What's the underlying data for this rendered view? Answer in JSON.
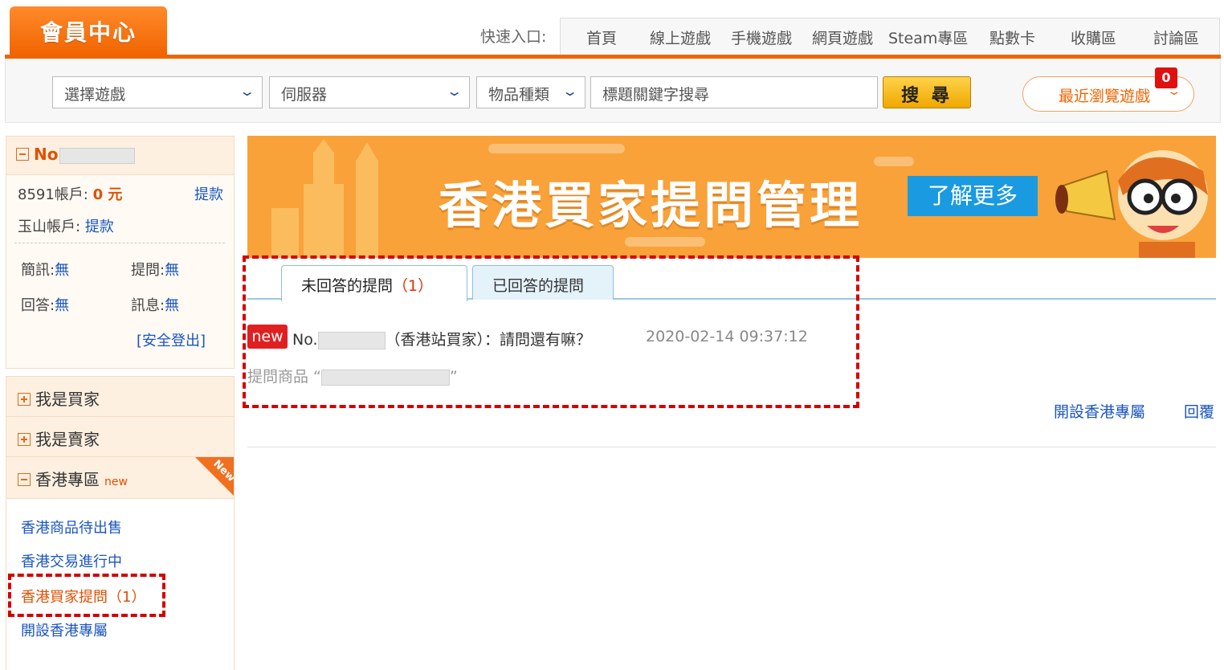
{
  "header": {
    "member_center": "會員中心",
    "quick_entry_label": "快速入口:",
    "nav": [
      "首頁",
      "線上遊戲",
      "手機遊戲",
      "網頁遊戲",
      "Steam專區",
      "點數卡",
      "收購區",
      "討論區"
    ]
  },
  "search": {
    "game_select": "選擇遊戲",
    "server_select": "伺服器",
    "item_type_select": "物品種類",
    "keyword_placeholder": "標題關鍵字搜尋",
    "search_button": "搜 尋",
    "recent_games": "最近瀏覽遊戲",
    "recent_count": "0"
  },
  "account": {
    "user_prefix": "No",
    "balance_label": "8591帳戶:",
    "balance_value": "0 元",
    "withdraw": "提款",
    "yushan_label": "玉山帳戶:",
    "yushan_withdraw": "提款",
    "sms_label": "簡訊:",
    "sms_value": "無",
    "ask_label": "提問:",
    "ask_value": "無",
    "reply_label": "回答:",
    "reply_value": "無",
    "msg_label": "訊息:",
    "msg_value": "無",
    "logout": "[安全登出]"
  },
  "menu": {
    "buyer": "我是買家",
    "seller": "我是賣家",
    "hk_zone": "香港專區",
    "hk_new": "new",
    "hk_ribbon": "New",
    "sub_items": [
      "香港商品待出售",
      "香港交易進行中",
      "香港買家提問（1）",
      "開設香港專屬"
    ]
  },
  "banner": {
    "title": "香港買家提問管理",
    "more": "了解更多"
  },
  "tabs": {
    "unanswered": "未回答的提問",
    "unanswered_count": "（1）",
    "answered": "已回答的提問"
  },
  "question": {
    "tag": "new",
    "no_prefix": "No.",
    "text": "（香港站買家）：請問還有嘛？",
    "time": "2020-02-14 09:37:12",
    "item_prefix": "提問商品 “",
    "item_suffix": "”"
  },
  "actions": {
    "open_hk": "開設香港專屬",
    "reply": "回覆"
  },
  "colors": {
    "brand_orange": "#f06400",
    "link_blue": "#1a55c0",
    "highlight_red": "#d40000"
  }
}
